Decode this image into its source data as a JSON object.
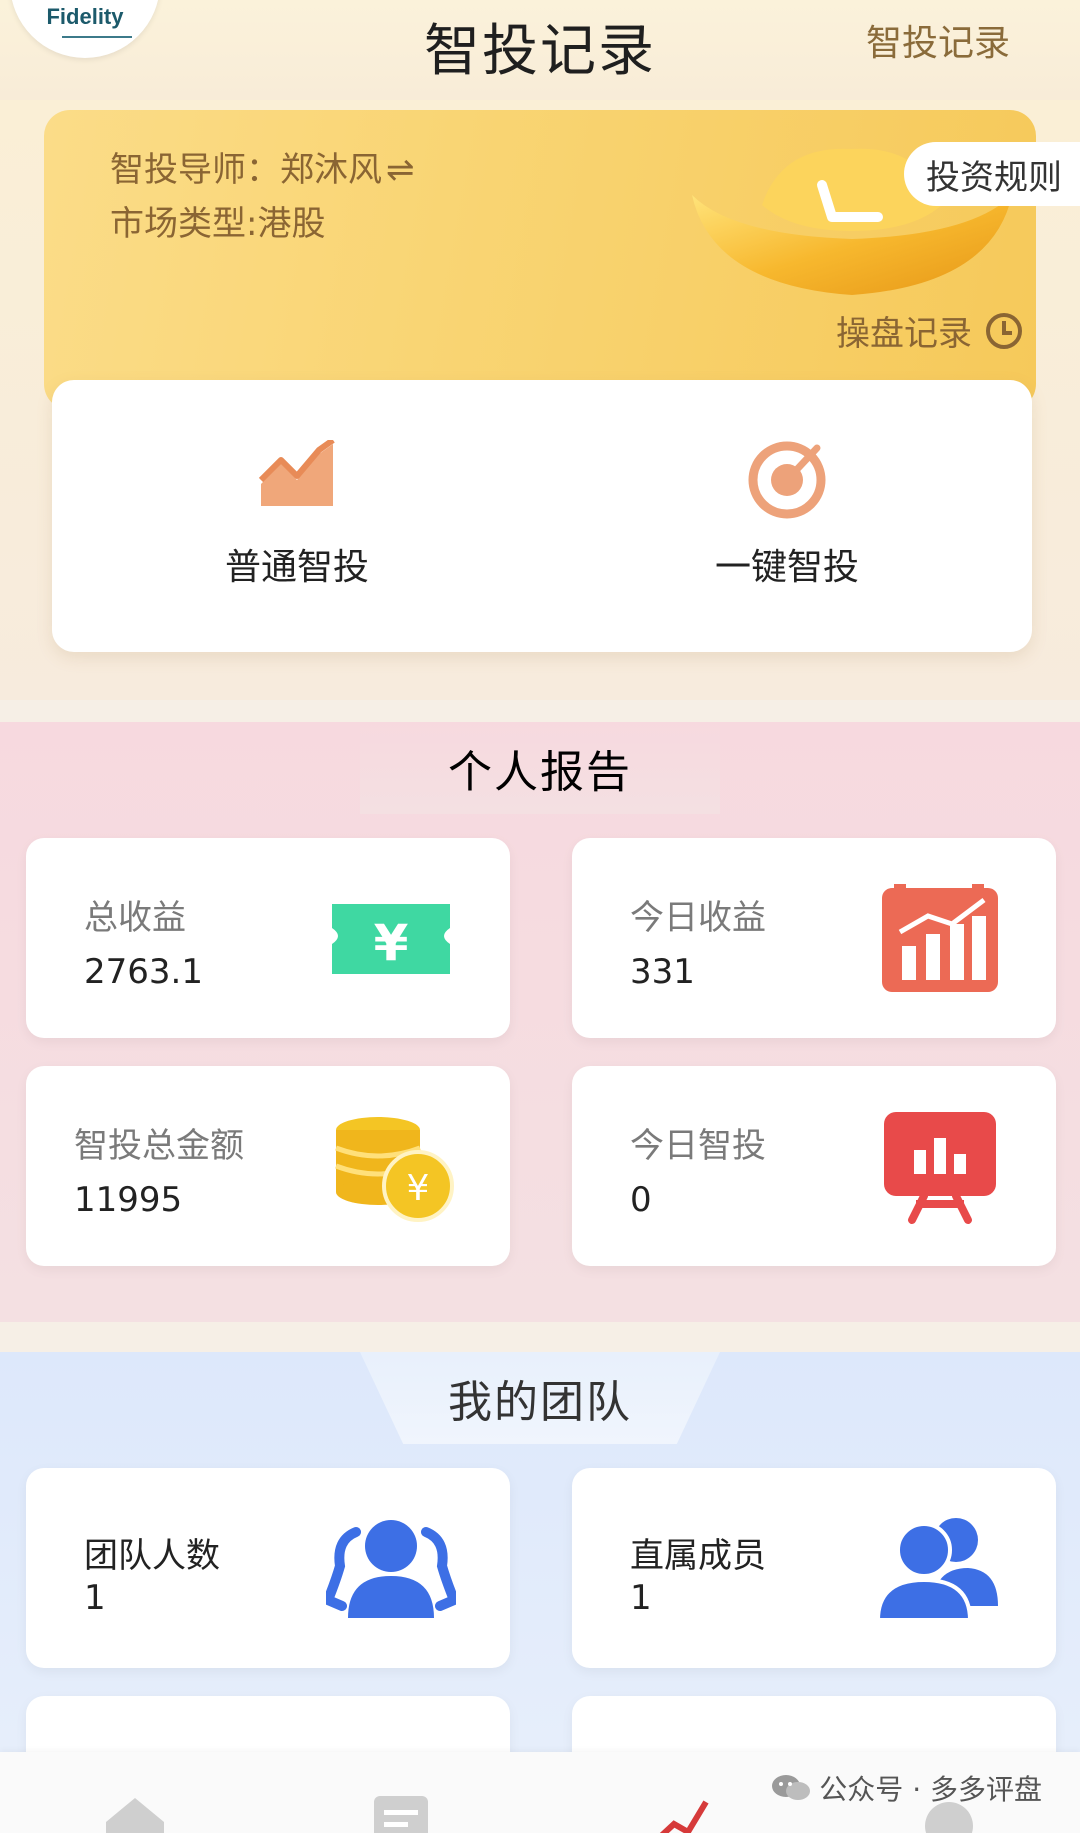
{
  "header": {
    "logo_text": "Fidelity",
    "title": "智投记录",
    "right_link": "智投记录"
  },
  "hero": {
    "mentor_label": "智投导师：郑沐风",
    "swap_icon": "⇌",
    "market_label": "市场类型:港股",
    "rules_button": "投资规则",
    "records_link": "操盘记录"
  },
  "modes": [
    {
      "label": "普通智投",
      "icon": "line-chart-icon"
    },
    {
      "label": "一键智投",
      "icon": "target-icon"
    }
  ],
  "personal_report": {
    "title": "个人报告",
    "cards": [
      {
        "label": "总收益",
        "value": "2763.1",
        "icon": "ticket-yen-icon",
        "color": "#3fd8a2"
      },
      {
        "label": "今日收益",
        "value": "331",
        "icon": "bar-chart-icon",
        "color": "#ec6a55"
      },
      {
        "label": "智投总金额",
        "value": "11995",
        "icon": "coins-icon",
        "color": "#f4c524"
      },
      {
        "label": "今日智投",
        "value": "0",
        "icon": "presentation-icon",
        "color": "#e84a4a"
      }
    ]
  },
  "team": {
    "title": "我的团队",
    "cards": [
      {
        "label": "团队人数",
        "value": "1",
        "icon": "group-icon",
        "color": "#3d6fe5"
      },
      {
        "label": "直属成员",
        "value": "1",
        "icon": "users-icon",
        "color": "#3d6fe5"
      }
    ]
  },
  "watermark": {
    "text": "公众号 · 多多评盘"
  },
  "colors": {
    "accent_gold": "#f6c95a",
    "report_red": "#b02b3b",
    "team_blue": "#3d6fe5"
  }
}
